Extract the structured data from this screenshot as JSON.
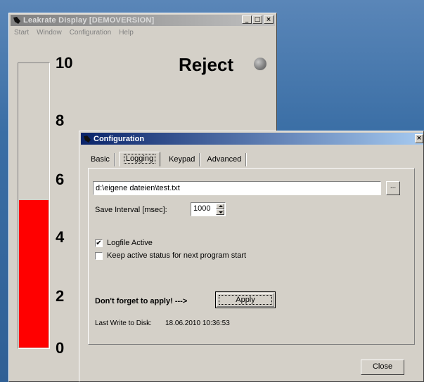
{
  "main_window": {
    "title": "Leakrate Display [DEMOVERSION]",
    "controls": {
      "minimize": "_",
      "maximize": "□",
      "close": "×"
    },
    "menu": [
      "Start",
      "Window",
      "Configuration",
      "Help"
    ],
    "scale_labels": [
      "10",
      "8",
      "6",
      "4",
      "2",
      "0"
    ],
    "gauge_value": 5.2,
    "gauge_max": 10,
    "gauge_color": "#ff0000",
    "status_text": "Reject",
    "status_led_icon": "status-led-gray"
  },
  "config_dialog": {
    "title": "Configuration",
    "close_glyph": "×",
    "tabs": [
      "Basic",
      "Logging",
      "Keypad",
      "Advanced"
    ],
    "active_tab": "Logging",
    "logfile_path": "d:\\eigene dateien\\test.txt",
    "browse_label": "...",
    "save_interval_label": "Save Interval [msec]:",
    "save_interval_value": "1000",
    "logfile_active_label": "Logfile Active",
    "logfile_active_checked": true,
    "check_glyph": "✔",
    "keep_status_label": "Keep active status for next program start",
    "keep_status_checked": false,
    "apply_hint": "Don't forget to apply! --->",
    "apply_label": "Apply",
    "last_write_label": "Last Write to Disk:",
    "last_write_value": "18.06.2010 10:36:53",
    "close_label": "Close"
  },
  "colors": {
    "desktop": "#3a6ea5",
    "window_face": "#d4d0c8",
    "active_title": "#0a246a",
    "inactive_title": "#808080"
  }
}
